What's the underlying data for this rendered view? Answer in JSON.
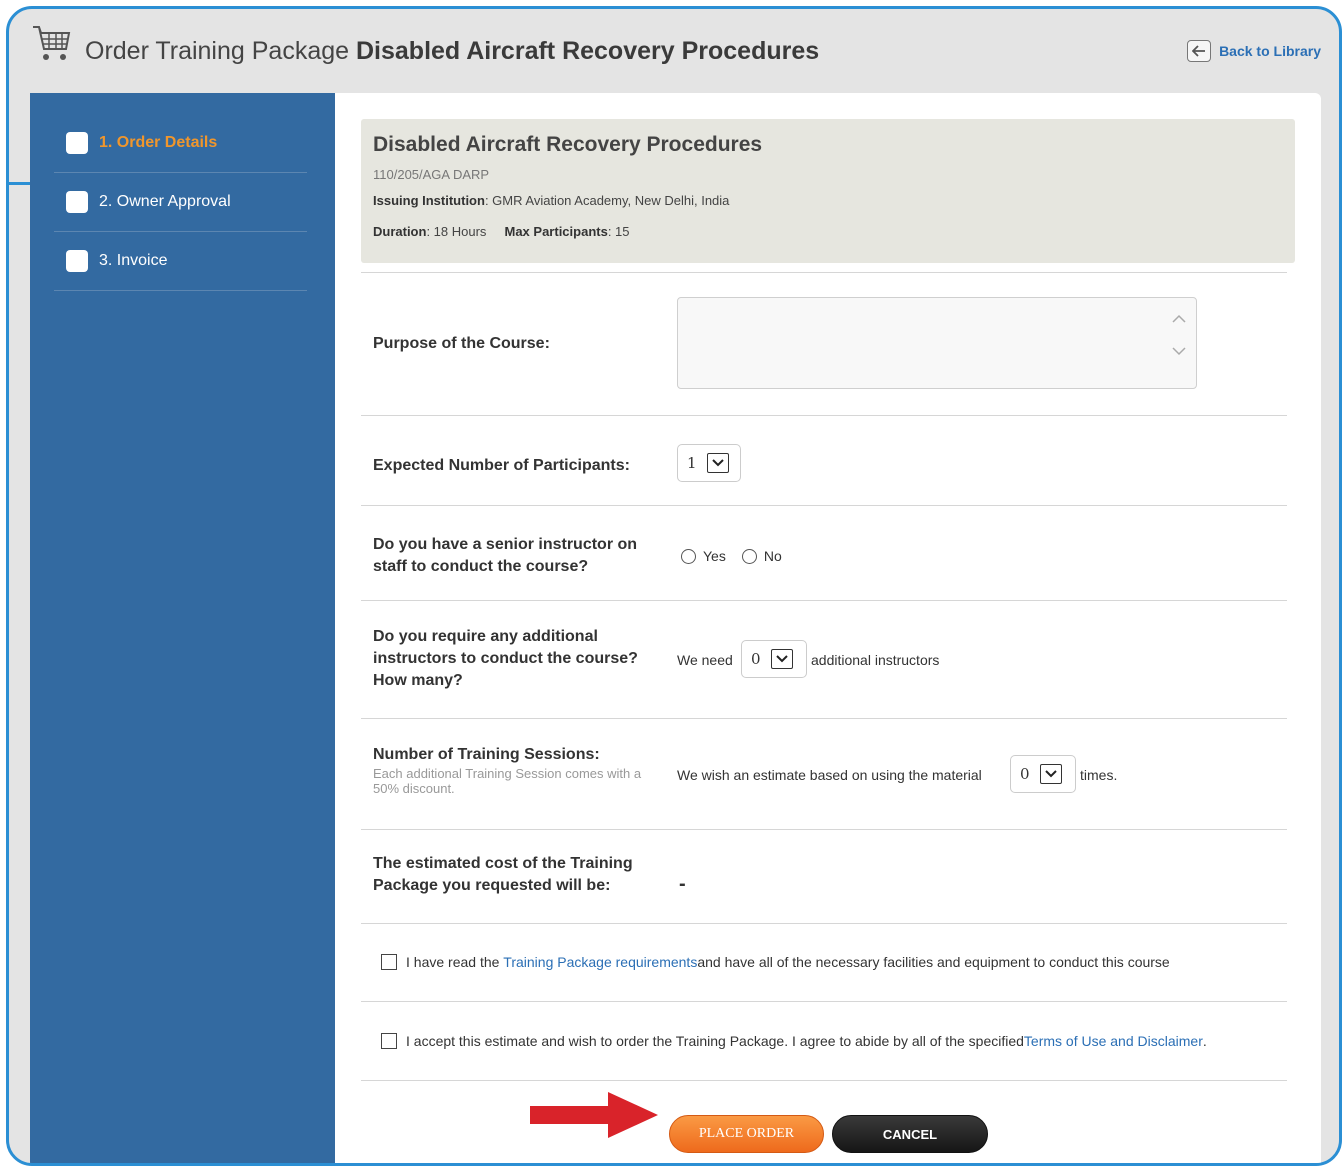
{
  "header": {
    "title_prefix": "Order Training Package",
    "title_course": "Disabled Aircraft Recovery Procedures",
    "back_label": "Back to Library",
    "cart_icon": "shopping-cart-icon",
    "back_icon": "arrow-left-icon"
  },
  "sidebar": {
    "items": [
      {
        "label": "1. Order Details",
        "active": true
      },
      {
        "label": "2. Owner Approval",
        "active": false
      },
      {
        "label": "3. Invoice",
        "active": false
      }
    ]
  },
  "course": {
    "title": "Disabled Aircraft Recovery Procedures",
    "code": "110/205/AGA DARP",
    "institution_label": "Issuing Institution",
    "institution_value": ": GMR Aviation Academy, New Delhi, India",
    "duration_label": "Duration",
    "duration_value": ": 18 Hours",
    "max_label": "Max Participants",
    "max_value": ": 15"
  },
  "form": {
    "purpose_label": "Purpose of the Course:",
    "purpose_value": "",
    "participants_label": "Expected Number of Participants:",
    "participants_value": "1",
    "senior_label": "Do you have a senior instructor on staff to conduct the course?",
    "senior_yes": "Yes",
    "senior_no": "No",
    "additional_label": "Do you require any additional instructors to conduct the course? How many?",
    "additional_prefix": "We need",
    "additional_value": "0",
    "additional_suffix": "additional instructors",
    "sessions_label": "Number of Training Sessions:",
    "sessions_sub": "Each additional Training Session comes with a 50% discount.",
    "sessions_prefix": "We wish an estimate based on using the material",
    "sessions_value": "0",
    "sessions_suffix": "times.",
    "cost_label": "The estimated cost of the Training Package you requested will be:",
    "cost_value": "-"
  },
  "agreements": {
    "req_prefix": "I have read the ",
    "req_link": "Training Package requirements",
    "req_suffix": " and have all of the necessary facilities and equipment to conduct this course",
    "terms_prefix": "I accept this estimate and wish to order the Training Package. I agree to abide by all of the specified ",
    "terms_link": "Terms of Use and Disclaimer",
    "terms_suffix": "."
  },
  "buttons": {
    "place_order": "PLACE ORDER",
    "cancel": "CANCEL"
  },
  "colors": {
    "frame": "#2b8fd4",
    "sidebar": "#336aa1",
    "active_step": "#f0962c",
    "link": "#2b6fb5",
    "place_order": "#f07a2a",
    "arrow": "#d9232a"
  }
}
